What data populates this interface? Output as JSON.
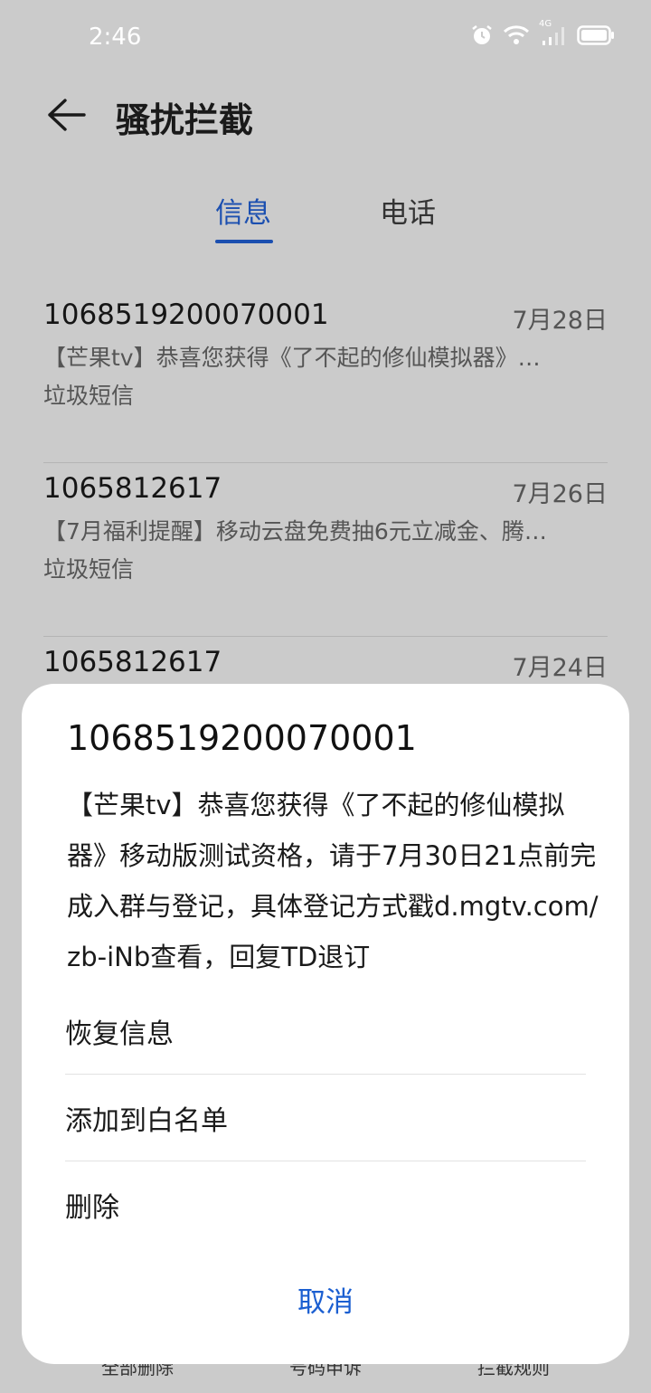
{
  "status_bar": {
    "time": "2:46",
    "network_label": "4G"
  },
  "header": {
    "title": "骚扰拦截"
  },
  "tabs": [
    {
      "label": "信息",
      "active": true
    },
    {
      "label": "电话",
      "active": false
    }
  ],
  "messages": [
    {
      "sender": "1068519200070001",
      "date": "7月28日",
      "preview": "【芒果tv】恭喜您获得《了不起的修仙模拟器》…",
      "type": "垃圾短信"
    },
    {
      "sender": "1065812617",
      "date": "7月26日",
      "preview": "【7月福利提醒】移动云盘免费抽6元立减金、腾…",
      "type": "垃圾短信"
    },
    {
      "sender": "1065812617",
      "date": "7月24日",
      "preview": "",
      "type": ""
    }
  ],
  "bottom_bar": {
    "items": [
      "全部删除",
      "号码申诉",
      "拦截规则"
    ]
  },
  "sheet": {
    "title": "1068519200070001",
    "body": "【芒果tv】恭喜您获得《了不起的修仙模拟器》移动版测试资格，请于7月30日21点前完成入群与登记，具体登记方式戳d.mgtv.com/zb-iNb查看，回复TD退订",
    "actions": {
      "restore": "恢复信息",
      "whitelist": "添加到白名单",
      "delete": "删除"
    },
    "cancel": "取消"
  },
  "colors": {
    "accent": "#1b4fb0",
    "cancel": "#1b5fd1",
    "dim_background": "#cbcbcb",
    "sheet_background": "#ffffff"
  }
}
